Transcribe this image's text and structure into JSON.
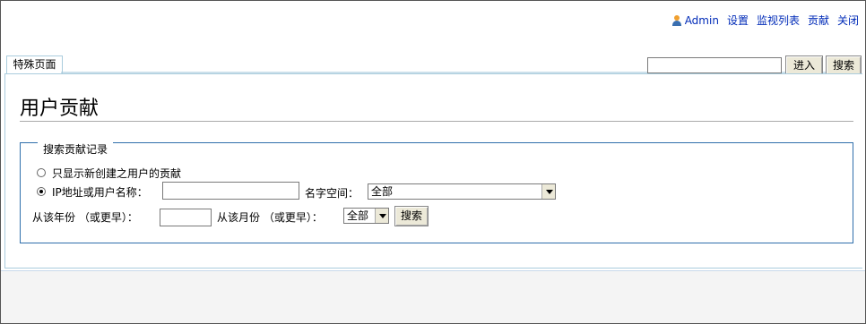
{
  "personal": {
    "username": "Admin",
    "links": [
      "设置",
      "监视列表",
      "贡献",
      "关闭"
    ]
  },
  "tab": {
    "label": "特殊页面"
  },
  "search": {
    "go_label": "进入",
    "search_label": "搜索",
    "value": ""
  },
  "page": {
    "title": "用户贡献"
  },
  "form": {
    "legend": "搜索贡献记录",
    "option_new_users": "只显示新创建之用户的贡献",
    "option_ip_user": "IP地址或用户名称：",
    "ip_user_value": "",
    "namespace_label": "名字空间：",
    "namespace_value": "全部",
    "year_label": "从该年份 （或更早）：",
    "year_value": "",
    "month_label": "从该月份 （或更早）：",
    "month_value": "全部",
    "submit_label": "搜索"
  }
}
